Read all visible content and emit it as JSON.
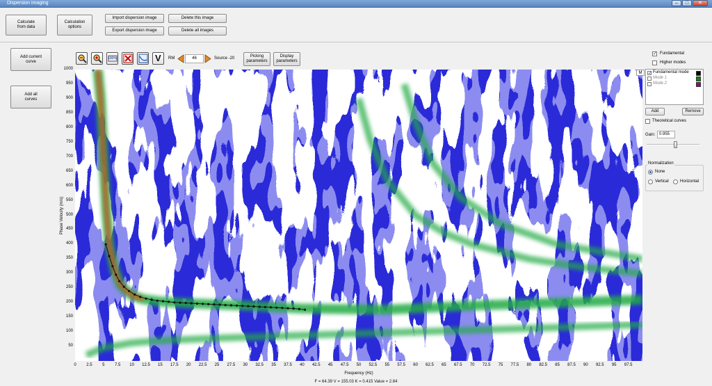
{
  "window": {
    "title": "Dispersion imaging",
    "minimize": "–",
    "maximize": "□",
    "close": "✕"
  },
  "toolbar": {
    "calculate_from_data": "Calculate\nfrom data",
    "calculation_options": "Calculation\noptions",
    "import_image": "Import dispersion image",
    "export_image": "Export dispersion image",
    "delete_image": "Delete this image",
    "delete_all_images": "Delete all images"
  },
  "left_panel": {
    "add_current_curve": "Add current\ncurve",
    "add_all_curves": "Add all\ncurves"
  },
  "plot_toolbar": {
    "icons": [
      "zoom-out-icon",
      "zoom-in-icon",
      "zoom-100-icon",
      "clear-icon",
      "auto-pick-icon",
      "velocity-v-icon"
    ],
    "zoom_100_label": "100%",
    "v_label": "V",
    "rm_label": "RM",
    "rm_value": "46",
    "source_label": "Source -20",
    "picking_parameters": "Picking\nparameters",
    "display_parameters": "Display\nparameters"
  },
  "right_panel": {
    "fundamental_label": "Fundamental",
    "fundamental_checked": true,
    "higher_modes_label": "Higher modes",
    "higher_modes_checked": false,
    "mode_corner": "M",
    "modes": [
      {
        "label": "Fundamental mode",
        "checked": true,
        "color": "#000000"
      },
      {
        "label": "Mode 1",
        "checked": false,
        "color": "#0a8a0a"
      },
      {
        "label": "Mode 2",
        "checked": false,
        "color": "#8a0a8a"
      }
    ],
    "add_label": "Add",
    "remove_label": "Remove",
    "theoretical_label": "Theoretical curves",
    "gain_label": "Gain:",
    "gain_value": "0.955",
    "gain_level": 0.55,
    "normalization_title": "Normalization",
    "none_label": "None",
    "vertical_label": "Vertical",
    "horizontal_label": "Horizontal",
    "normalization_selected": "None"
  },
  "status_text": "F = 64.39 V = 155.03 K = 0.415 Value = 2.84",
  "chart_data": {
    "type": "heatmap",
    "xlabel": "Frequency (Hz)",
    "ylabel": "Phase Velocity (m/s)",
    "xlim": [
      0,
      100
    ],
    "ylim": [
      0,
      1000
    ],
    "x_ticks": [
      0,
      2.5,
      5,
      7.5,
      10,
      12.5,
      15,
      17.5,
      20,
      22.5,
      25,
      27.5,
      30,
      32.5,
      35,
      37.5,
      40,
      42.5,
      45,
      47.5,
      50,
      52.5,
      55,
      57.5,
      60,
      62.5,
      65,
      67.5,
      70,
      72.5,
      75,
      77.5,
      80,
      82.5,
      85,
      87.5,
      90,
      92.5,
      95,
      97.5
    ],
    "y_ticks": [
      50,
      100,
      150,
      200,
      250,
      300,
      350,
      400,
      450,
      500,
      550,
      600,
      650,
      700,
      750,
      800,
      850,
      900,
      950,
      1000
    ],
    "colormap": [
      "#ffffff",
      "#8c8cf0",
      "#2a2ad8",
      "#22aa44",
      "#e05020"
    ],
    "picked_curve": {
      "x": [
        5.4,
        6.0,
        6.6,
        7.2,
        7.8,
        8.6,
        9.5,
        10.5,
        11.5,
        12.5,
        13.5,
        14.5,
        15.5,
        16.5,
        17.5,
        18.5,
        19.5,
        20.5,
        21.5,
        22.5,
        23.5,
        24.5,
        25.5,
        26.5,
        27.5,
        28.5,
        29.5,
        30.5,
        31.5,
        32.5,
        33.5,
        34.5,
        35.5,
        36.5,
        37.5,
        38.5,
        39.5,
        40.5
      ],
      "y": [
        400,
        360,
        325,
        296,
        274,
        255,
        240,
        228,
        220,
        214,
        210,
        207,
        205,
        203,
        201,
        200,
        199,
        198,
        197,
        196,
        195,
        194,
        193,
        192,
        191,
        190,
        189,
        188,
        187,
        186,
        185,
        184,
        183,
        182,
        181,
        180,
        178,
        176
      ]
    },
    "dispersion_ridges": [
      {
        "name": "",
        "x": [
          4,
          4.5,
          5,
          5.5,
          6,
          7,
          8,
          10,
          12,
          15,
          20,
          30,
          40,
          55,
          70,
          85,
          100
        ],
        "y": [
          1000,
          900,
          700,
          520,
          400,
          310,
          260,
          225,
          212,
          204,
          198,
          190,
          180,
          176,
          190,
          200,
          210
        ]
      },
      {
        "name": "",
        "x": [
          2,
          5,
          10,
          15,
          25,
          40,
          60,
          80,
          100
        ],
        "y": [
          20,
          45,
          62,
          70,
          78,
          88,
          100,
          112,
          125
        ]
      },
      {
        "name": "",
        "x": [
          50,
          52,
          55,
          60,
          65,
          70,
          80,
          90,
          100
        ],
        "y": [
          900,
          760,
          620,
          500,
          440,
          400,
          350,
          320,
          300
        ]
      },
      {
        "name": "",
        "x": [
          58,
          60,
          63,
          68,
          75,
          85,
          100
        ],
        "y": [
          950,
          820,
          680,
          560,
          470,
          400,
          350
        ]
      }
    ]
  }
}
